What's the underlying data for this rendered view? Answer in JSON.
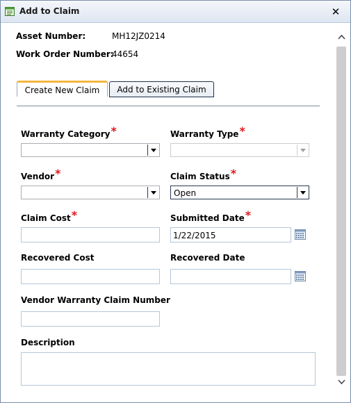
{
  "window": {
    "title": "Add to Claim",
    "close_glyph": "✕"
  },
  "info": {
    "asset_label": "Asset Number:",
    "asset_value": "MH12JZ0214",
    "wo_label": "Work Order Number:",
    "wo_value": "44654"
  },
  "tabs": [
    {
      "label": "Create New Claim",
      "active": true
    },
    {
      "label": "Add to Existing Claim",
      "active": false
    }
  ],
  "form": {
    "required_marker": "*",
    "warranty_category": {
      "label": "Warranty Category",
      "value": ""
    },
    "warranty_type": {
      "label": "Warranty Type",
      "value": ""
    },
    "vendor": {
      "label": "Vendor",
      "value": ""
    },
    "claim_status": {
      "label": "Claim Status",
      "value": "Open"
    },
    "claim_cost": {
      "label": "Claim Cost",
      "value": ""
    },
    "submitted_date": {
      "label": "Submitted Date",
      "value": "1/22/2015"
    },
    "recovered_cost": {
      "label": "Recovered Cost",
      "value": ""
    },
    "recovered_date": {
      "label": "Recovered Date",
      "value": ""
    },
    "vendor_warranty_claim_number": {
      "label": "Vendor Warranty Claim Number",
      "value": ""
    },
    "description": {
      "label": "Description",
      "value": ""
    }
  },
  "icons": {
    "title": "form-icon",
    "close": "close-icon",
    "calendar": "calendar-icon",
    "dropdown": "chevron-down-icon",
    "scroll_up": "scroll-up-icon",
    "scroll_down": "scroll-down-icon"
  },
  "colors": {
    "active_tab_accent": "#f3b63e",
    "required": "#e0181f",
    "title_bar": "#dde6f1"
  }
}
